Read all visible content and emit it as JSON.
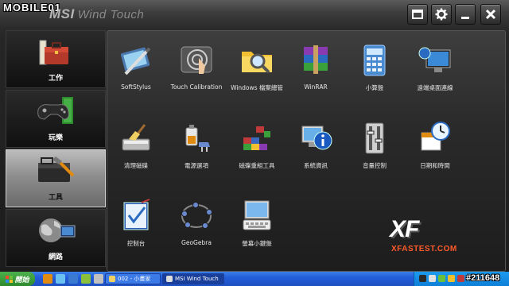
{
  "watermark": {
    "text": "MOBILE01"
  },
  "header": {
    "brand_main": "MSI",
    "brand_sub": "Wind Touch",
    "buttons": [
      "window-icon",
      "gear-icon",
      "minimize-icon",
      "close-icon"
    ]
  },
  "sidebar": {
    "items": [
      {
        "label": "工作",
        "icon": "briefcase-icon",
        "active": false
      },
      {
        "label": "玩樂",
        "icon": "gamepad-icon",
        "active": false
      },
      {
        "label": "工具",
        "icon": "toolbox-icon",
        "active": true
      },
      {
        "label": "網路",
        "icon": "globe-icon",
        "active": false
      }
    ]
  },
  "tiles": [
    {
      "label": "SoftStylus",
      "icon": "stylus-icon"
    },
    {
      "label": "Touch Calibration",
      "icon": "touch-calibration-icon"
    },
    {
      "label": "Windows 檔案總管",
      "icon": "folder-search-icon"
    },
    {
      "label": "WinRAR",
      "icon": "winrar-icon"
    },
    {
      "label": "小算盤",
      "icon": "calculator-icon"
    },
    {
      "label": "遠端桌面連線",
      "icon": "remote-desktop-icon"
    },
    {
      "label": "清理磁碟",
      "icon": "disk-cleanup-icon"
    },
    {
      "label": "電源選項",
      "icon": "power-options-icon"
    },
    {
      "label": "磁碟重組工具",
      "icon": "defrag-icon"
    },
    {
      "label": "系統資訊",
      "icon": "system-info-icon"
    },
    {
      "label": "音量控制",
      "icon": "volume-control-icon"
    },
    {
      "label": "日期和時間",
      "icon": "date-time-icon"
    },
    {
      "label": "控制台",
      "icon": "control-panel-icon"
    },
    {
      "label": "GeoGebra",
      "icon": "geogebra-icon"
    },
    {
      "label": "螢幕小鍵盤",
      "icon": "onscreen-keyboard-icon"
    }
  ],
  "badge": {
    "text": "XF",
    "url": "XFASTEST.COM"
  },
  "taskbar": {
    "start_label": "開始",
    "tasks": [
      "002 - 小畫家",
      "MSI Wind Touch"
    ]
  },
  "clock": "#211648"
}
